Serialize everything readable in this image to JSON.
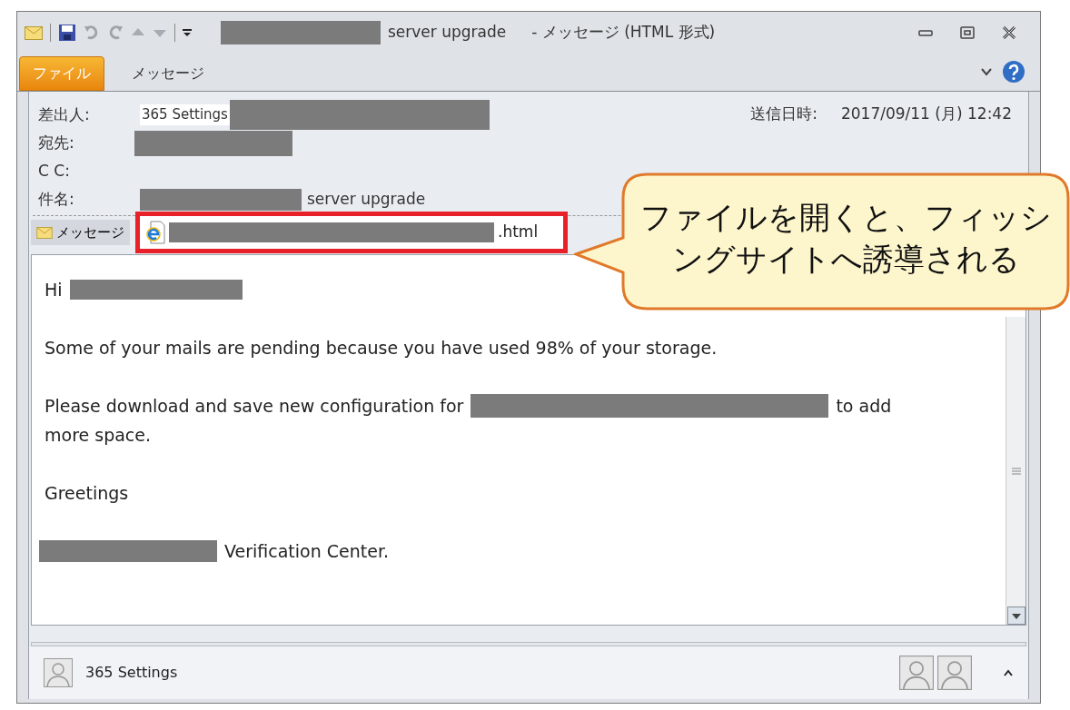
{
  "window": {
    "title": "server upgrade",
    "title_suffix": "- メッセージ (HTML 形式)"
  },
  "tabs": [
    {
      "label": "ファイル",
      "selected": true
    },
    {
      "label": "メッセージ",
      "selected": false
    }
  ],
  "header": {
    "fields": [
      {
        "label": "差出人:",
        "value": [
          {
            "kind": "text",
            "text": "365 Settings"
          },
          {
            "kind": "redaction"
          }
        ]
      },
      {
        "label": "宛先:",
        "value": [
          {
            "kind": "redaction"
          }
        ]
      },
      {
        "label": "C C:"
      },
      {
        "label": "件名:",
        "value": [
          {
            "kind": "redaction"
          },
          {
            "kind": "text",
            "text": "server upgrade"
          }
        ]
      }
    ],
    "sent_label": "送信日時:",
    "sent_value": "2017/09/11 (月) 12:42"
  },
  "attachments": {
    "message_tab": "メッセージ",
    "file": ".html",
    "highlighted": true
  },
  "body": {
    "paragraphs": [
      [
        [
          {
            "kind": "text",
            "text": "Hi"
          },
          {
            "kind": "redaction"
          }
        ]
      ],
      [
        [
          {
            "kind": "text",
            "text": "Some of your mails are pending because you have used 98% of your storage."
          }
        ]
      ],
      [
        [
          {
            "kind": "text",
            "text": "Please download and save new configuration for"
          },
          {
            "kind": "redaction"
          },
          {
            "kind": "text",
            "text": "to add"
          }
        ],
        [
          {
            "kind": "text",
            "text": "more space."
          }
        ]
      ],
      [
        [
          {
            "kind": "text",
            "text": "Greetings"
          }
        ]
      ],
      [
        [
          {
            "kind": "redaction"
          },
          {
            "kind": "text",
            "text": "Verification Center."
          }
        ]
      ]
    ]
  },
  "people_pane": {
    "name": "365 Settings"
  },
  "callout": {
    "text": "ファイルを開くと、フィッシングサイトへ誘導される"
  }
}
